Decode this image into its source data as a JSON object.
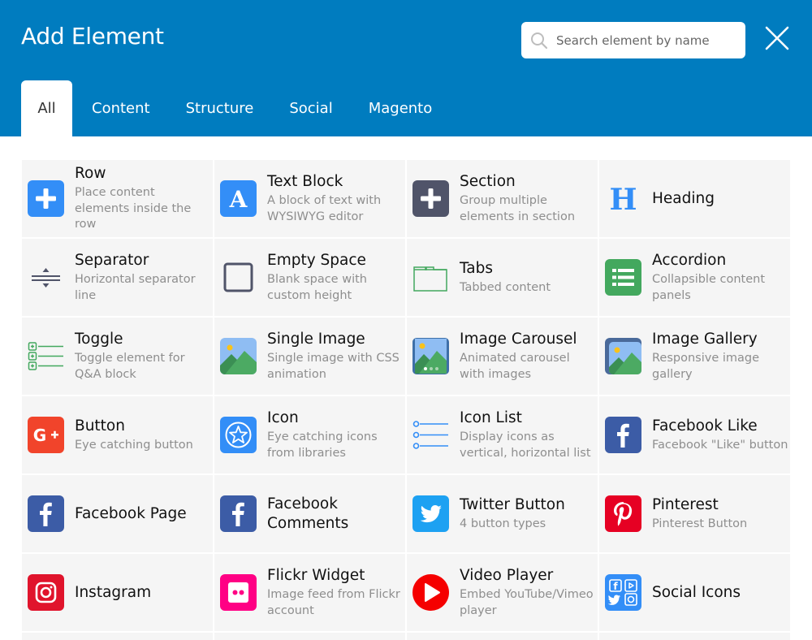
{
  "header": {
    "title": "Add Element",
    "search": {
      "placeholder": "Search element by name",
      "value": ""
    },
    "close_icon": "close-icon"
  },
  "tabs": [
    {
      "label": "All",
      "active": true
    },
    {
      "label": "Content",
      "active": false
    },
    {
      "label": "Structure",
      "active": false
    },
    {
      "label": "Social",
      "active": false
    },
    {
      "label": "Magento",
      "active": false
    }
  ],
  "colors": {
    "header_bg": "#007cbf",
    "tile_bg": "#f5f5f5",
    "blue": "#338ef7",
    "dark": "#505469",
    "green": "#43a85e",
    "facebook": "#3c5ca6",
    "twitter": "#1da1f2",
    "pinterest": "#e60023",
    "instagram": "#e0142c",
    "flickr": "#ff0084",
    "youtube": "#f50000",
    "gplus": "#f1442b"
  },
  "elements": [
    {
      "name": "Row",
      "description": "Place content elements inside the row",
      "icon": "row-plus-icon"
    },
    {
      "name": "Text Block",
      "description": "A block of text with WYSIWYG editor",
      "icon": "text-block-icon"
    },
    {
      "name": "Section",
      "description": "Group multiple elements in section",
      "icon": "section-plus-icon"
    },
    {
      "name": "Heading",
      "description": "",
      "icon": "heading-icon"
    },
    {
      "name": "Separator",
      "description": "Horizontal separator line",
      "icon": "separator-icon"
    },
    {
      "name": "Empty Space",
      "description": "Blank space with custom height",
      "icon": "empty-space-icon"
    },
    {
      "name": "Tabs",
      "description": "Tabbed content",
      "icon": "tabs-icon"
    },
    {
      "name": "Accordion",
      "description": "Collapsible content panels",
      "icon": "accordion-icon"
    },
    {
      "name": "Toggle",
      "description": "Toggle element for Q&A block",
      "icon": "toggle-icon"
    },
    {
      "name": "Single Image",
      "description": "Single image with CSS animation",
      "icon": "single-image-icon"
    },
    {
      "name": "Image Carousel",
      "description": "Animated carousel with images",
      "icon": "image-carousel-icon"
    },
    {
      "name": "Image Gallery",
      "description": "Responsive image gallery",
      "icon": "image-gallery-icon"
    },
    {
      "name": "Button",
      "description": "Eye catching button",
      "icon": "google-plus-icon"
    },
    {
      "name": "Icon",
      "description": "Eye catching icons from libraries",
      "icon": "star-icon"
    },
    {
      "name": "Icon List",
      "description": "Display icons as vertical, horizontal list",
      "icon": "icon-list-icon"
    },
    {
      "name": "Facebook Like",
      "description": "Facebook \"Like\" button",
      "icon": "facebook-icon"
    },
    {
      "name": "Facebook Page",
      "description": "",
      "icon": "facebook-icon"
    },
    {
      "name": "Facebook Comments",
      "description": "",
      "icon": "facebook-icon"
    },
    {
      "name": "Twitter Button",
      "description": "4 button types",
      "icon": "twitter-icon"
    },
    {
      "name": "Pinterest",
      "description": "Pinterest Button",
      "icon": "pinterest-icon"
    },
    {
      "name": "Instagram",
      "description": "",
      "icon": "instagram-icon"
    },
    {
      "name": "Flickr Widget",
      "description": "Image feed from Flickr account",
      "icon": "flickr-icon"
    },
    {
      "name": "Video Player",
      "description": "Embed YouTube/Vimeo player",
      "icon": "youtube-icon"
    },
    {
      "name": "Social Icons",
      "description": "",
      "icon": "social-icons-icon"
    }
  ]
}
